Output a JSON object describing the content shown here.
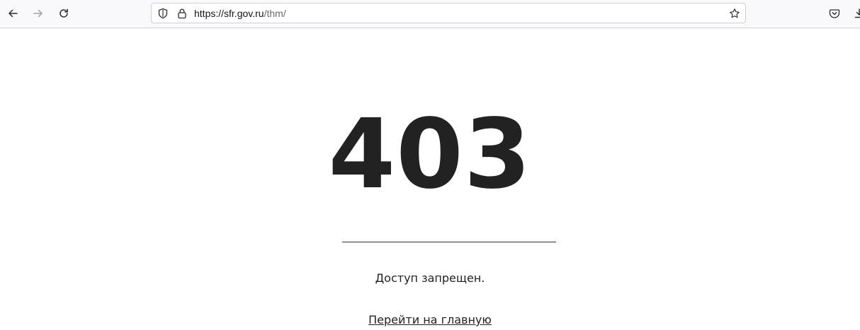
{
  "browser": {
    "back_icon": "arrow-left-icon",
    "forward_icon": "arrow-right-icon",
    "reload_icon": "reload-icon",
    "url_host": "https://sfr.gov.ru",
    "url_path": "/thm/",
    "shield_icon": "shield-icon",
    "lock_icon": "lock-icon",
    "bookmark_icon": "star-icon",
    "pocket_icon": "pocket-icon",
    "downloads_icon": "download-icon"
  },
  "page": {
    "error_code": "403",
    "message": "Доступ запрещен.",
    "home_link": "Перейти на главную"
  },
  "colors": {
    "text": "#222222",
    "toolbar_bg": "#f9f9fb"
  }
}
